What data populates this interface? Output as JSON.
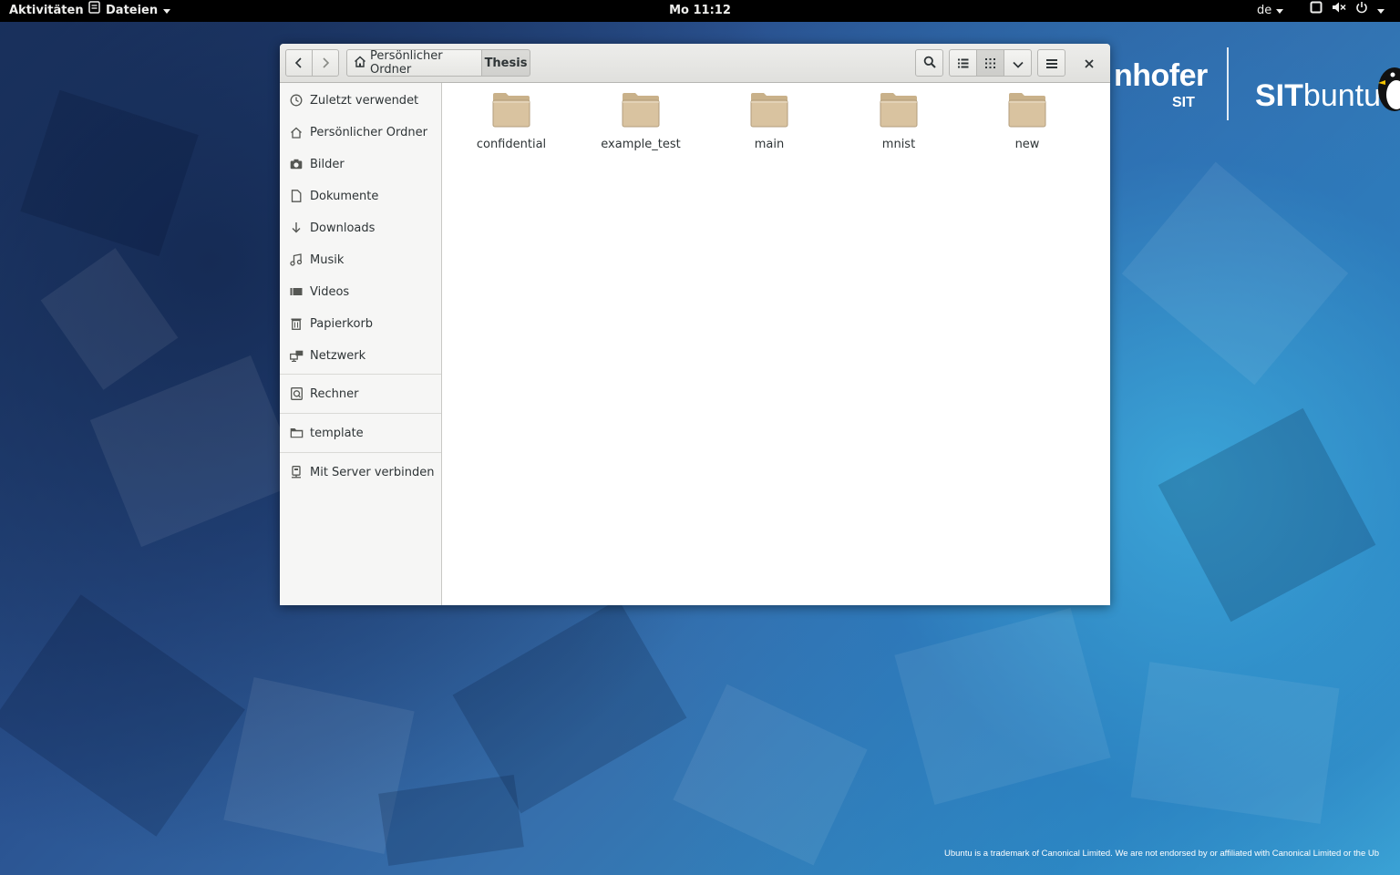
{
  "topbar": {
    "activities": "Aktivitäten",
    "app_menu": "Dateien",
    "clock": "Mo 11:12",
    "keyboard_layout": "de"
  },
  "branding": {
    "org_text": "nhofer",
    "org_sub": "SIT",
    "product_bold": "SIT",
    "product_rest": "buntu",
    "trademark": "Ubuntu is a trademark of Canonical Limited. We are not endorsed by or affiliated with Canonical Limited or the Ub"
  },
  "window": {
    "breadcrumb": {
      "home_label": "Persönlicher Ordner",
      "current_label": "Thesis"
    }
  },
  "sidebar": {
    "items": [
      {
        "label": "Zuletzt verwendet",
        "icon": "clock-icon"
      },
      {
        "label": "Persönlicher Ordner",
        "icon": "home-icon"
      },
      {
        "label": "Bilder",
        "icon": "camera-icon"
      },
      {
        "label": "Dokumente",
        "icon": "document-icon"
      },
      {
        "label": "Downloads",
        "icon": "download-icon"
      },
      {
        "label": "Musik",
        "icon": "music-icon"
      },
      {
        "label": "Videos",
        "icon": "video-icon"
      },
      {
        "label": "Papierkorb",
        "icon": "trash-icon"
      },
      {
        "label": "Netzwerk",
        "icon": "network-icon"
      }
    ],
    "devices": [
      {
        "label": "Rechner",
        "icon": "computer-icon"
      }
    ],
    "bookmarks": [
      {
        "label": "template",
        "icon": "folder-icon"
      }
    ],
    "connect": {
      "label": "Mit Server verbinden",
      "icon": "server-icon"
    }
  },
  "files": [
    {
      "name": "confidential"
    },
    {
      "name": "example_test"
    },
    {
      "name": "main"
    },
    {
      "name": "mnist"
    },
    {
      "name": "new"
    }
  ],
  "colors": {
    "folder_fill": "#d9c3a0",
    "folder_tab": "#c9b18a",
    "topbar_bg": "#000000"
  }
}
